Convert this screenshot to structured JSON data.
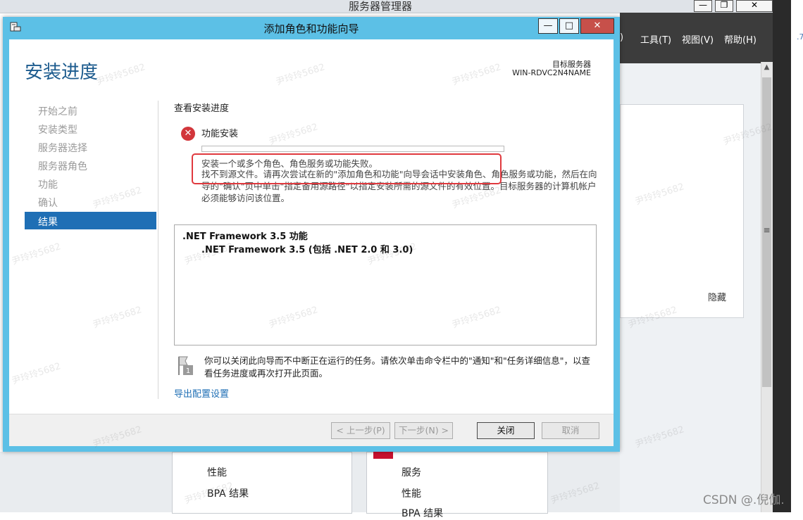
{
  "server_manager": {
    "title": "服务器管理器",
    "controls": [
      "—",
      "❐",
      "✕"
    ],
    "menu": [
      "工具(T)",
      "视图(V)",
      "帮助(H)"
    ],
    "menu_partial": ")",
    "hide_label": "隐藏",
    "far_right_mark": ".7",
    "lower_left_card": [
      "性能",
      "BPA 结果"
    ],
    "lower_right_card": [
      "服务",
      "性能",
      "BPA 结果"
    ]
  },
  "watermark": "尹玲玲5682",
  "csdn_mark": "CSDN @.倪伽.",
  "wizard": {
    "title": "添加角色和功能向导",
    "controls": {
      "minimize": "—",
      "maximize": "□",
      "close": "✕"
    },
    "heading": "安装进度",
    "destination_label": "目标服务器",
    "destination_name": "WIN-RDVC2N4NAME",
    "steps": [
      "开始之前",
      "安装类型",
      "服务器选择",
      "服务器角色",
      "功能",
      "确认",
      "结果"
    ],
    "active_step": "结果",
    "section_title": "查看安装进度",
    "feature_install_label": "功能安装",
    "error_message_line1": "安装一个或多个角色、角色服务或功能失败。",
    "error_message_line2": "找不到源文件。请再次尝试在新的\"添加角色和功能\"向导会话中安装角色、角色服务或功能，然后在向导的\"确认\"页中单击\"指定备用源路径\"以指定安装所需的源文件的有效位置。目标服务器的计算机帐户必须能够访问该位置。",
    "items": [
      ".NET Framework 3.5 功能",
      ".NET Framework 3.5 (包括 .NET 2.0 和 3.0)"
    ],
    "note": "你可以关闭此向导而不中断正在运行的任务。请依次单击命令栏中的\"通知\"和\"任务详细信息\"，以查看任务进度或再次打开此页面。",
    "export_link": "导出配置设置",
    "buttons": {
      "previous": "< 上一步(P)",
      "next": "下一步(N) >",
      "close": "关闭",
      "cancel": "取消"
    }
  }
}
